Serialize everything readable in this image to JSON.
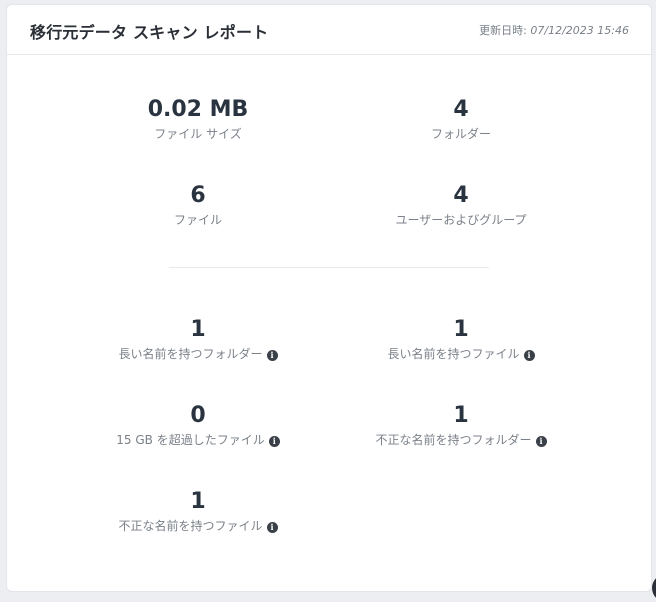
{
  "header": {
    "title": "移行元データ スキャン レポート",
    "updated_label": "更新日時:",
    "updated_value": "07/12/2023 15:46"
  },
  "summary": [
    {
      "value": "0.02 MB",
      "label": "ファイル サイズ"
    },
    {
      "value": "4",
      "label": "フォルダー"
    },
    {
      "value": "6",
      "label": "ファイル"
    },
    {
      "value": "4",
      "label": "ユーザーおよびグループ"
    }
  ],
  "issues": [
    {
      "value": "1",
      "label": "長い名前を持つフォルダー",
      "icon": "info-icon"
    },
    {
      "value": "1",
      "label": "長い名前を持つファイル",
      "icon": "info-icon"
    },
    {
      "value": "0",
      "label": "15 GB を超過したファイル",
      "icon": "info-icon"
    },
    {
      "value": "1",
      "label": "不正な名前を持つフォルダー",
      "icon": "info-icon"
    },
    {
      "value": "1",
      "label": "不正な名前を持つファイル",
      "icon": "info-icon"
    }
  ]
}
